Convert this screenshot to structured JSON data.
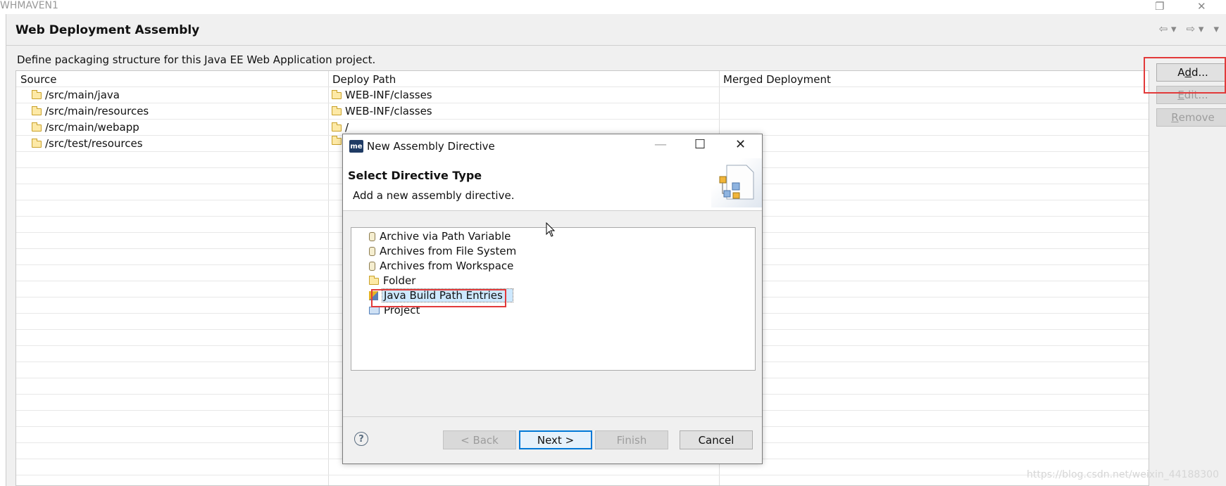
{
  "window": {
    "title": "WHMAVEN1",
    "controls": {
      "restore": "❐",
      "close": "✕"
    }
  },
  "page": {
    "title": "Web Deployment Assembly",
    "nav": {
      "back": "⇦ ▾",
      "forward": "⇨ ▾",
      "menu": "▾"
    },
    "description": "Define packaging structure for this Java EE Web Application project."
  },
  "table": {
    "columns": [
      "Source",
      "Deploy Path",
      "Merged Deployment"
    ],
    "sort_glyph": "^",
    "rows": [
      {
        "source": "/src/main/java",
        "deploy": "WEB-INF/classes"
      },
      {
        "source": "/src/main/resources",
        "deploy": "WEB-INF/classes"
      },
      {
        "source": "/src/main/webapp",
        "deploy": "/"
      },
      {
        "source": "/src/test/resources",
        "deploy": ""
      }
    ]
  },
  "side_buttons": {
    "add": {
      "pre": "A",
      "mnemonic": "d",
      "post": "d..."
    },
    "edit": {
      "pre": "",
      "mnemonic": "E",
      "post": "dit..."
    },
    "remove": {
      "pre": "",
      "mnemonic": "R",
      "post": "emove"
    }
  },
  "dialog": {
    "icon_text": "me",
    "title": "New Assembly Directive",
    "controls": {
      "minimize": "—",
      "maximize": "☐",
      "close": "✕"
    },
    "header_title": "Select Directive Type",
    "header_desc": "Add a new assembly directive.",
    "items": [
      {
        "label": "Archive via Path Variable",
        "icon": "jar-icon"
      },
      {
        "label": "Archives from File System",
        "icon": "jar-icon"
      },
      {
        "label": "Archives from Workspace",
        "icon": "jar-icon"
      },
      {
        "label": "Folder",
        "icon": "folder-icon"
      },
      {
        "label": "Java Build Path Entries",
        "icon": "build-path-icon",
        "selected": true
      },
      {
        "label": "Project",
        "icon": "project-folder-icon"
      }
    ],
    "help_glyph": "?",
    "buttons": {
      "back": "< Back",
      "next": "Next >",
      "finish": "Finish",
      "cancel": "Cancel"
    }
  },
  "watermark": "https://blog.csdn.net/weixin_44188300",
  "colors": {
    "highlight": "#e23a3a",
    "selection": "#cde8ff",
    "default_button": "#0078d7"
  }
}
